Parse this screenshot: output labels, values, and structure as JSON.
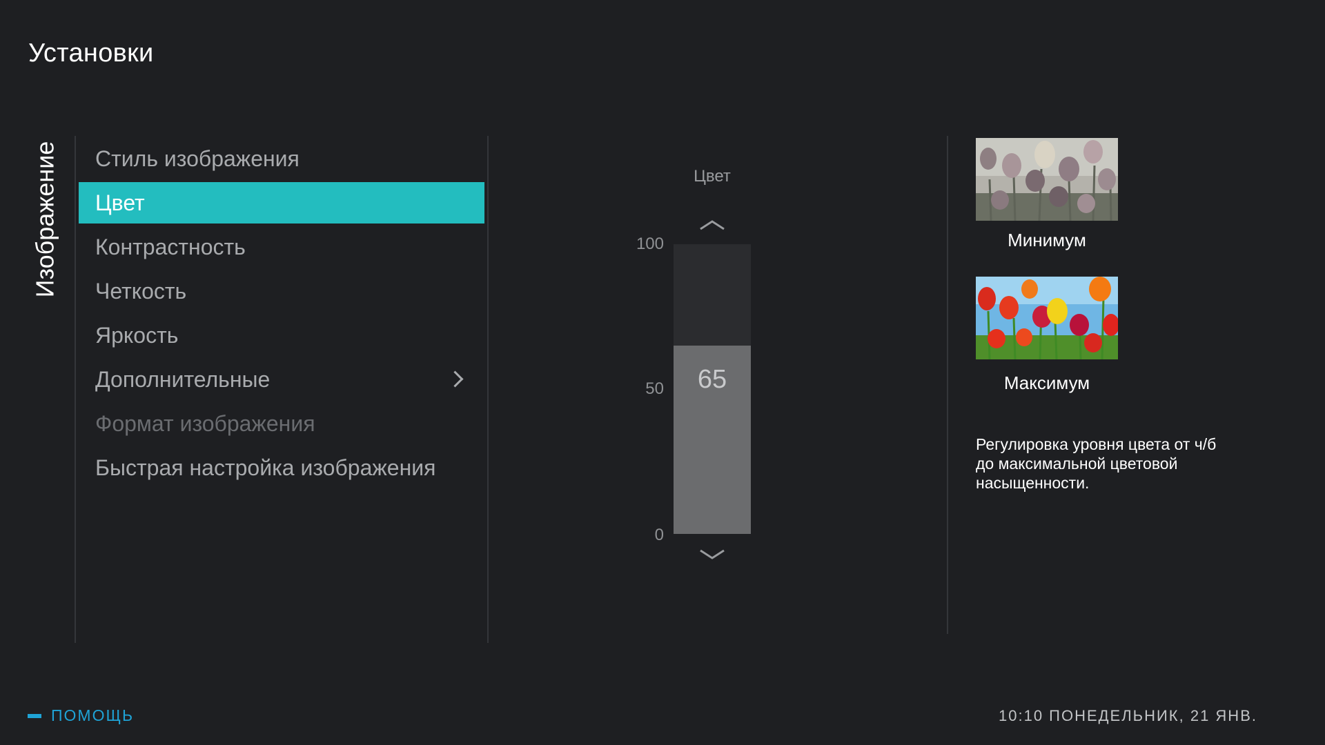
{
  "header": {
    "title": "Установки"
  },
  "section": {
    "label": "Изображение"
  },
  "menu": {
    "items": [
      {
        "label": "Стиль изображения",
        "state": "normal"
      },
      {
        "label": "Цвет",
        "state": "active"
      },
      {
        "label": "Контрастность",
        "state": "normal"
      },
      {
        "label": "Четкость",
        "state": "normal"
      },
      {
        "label": "Яркость",
        "state": "normal"
      },
      {
        "label": "Дополнительные",
        "state": "normal",
        "submenu": true
      },
      {
        "label": "Формат изображения",
        "state": "disabled"
      },
      {
        "label": "Быстрая настройка изображения",
        "state": "normal"
      }
    ]
  },
  "slider": {
    "title": "Цвет",
    "value": "65",
    "level": 65,
    "min": 0,
    "max": 100,
    "ticks": {
      "max": "100",
      "mid": "50",
      "min": "0"
    }
  },
  "preview": {
    "min_label": "Минимум",
    "max_label": "Максимум",
    "description": "Регулировка уровня цвета от ч/б до максимальной цветовой насыщенности."
  },
  "footer": {
    "help_label": "ПОМОЩЬ",
    "clock": "10:10 ПОНЕДЕЛЬНИК, 21 ЯНВ."
  },
  "colors": {
    "accent": "#23bdbf",
    "help": "#1fa3d6",
    "background": "#1e1f22"
  }
}
